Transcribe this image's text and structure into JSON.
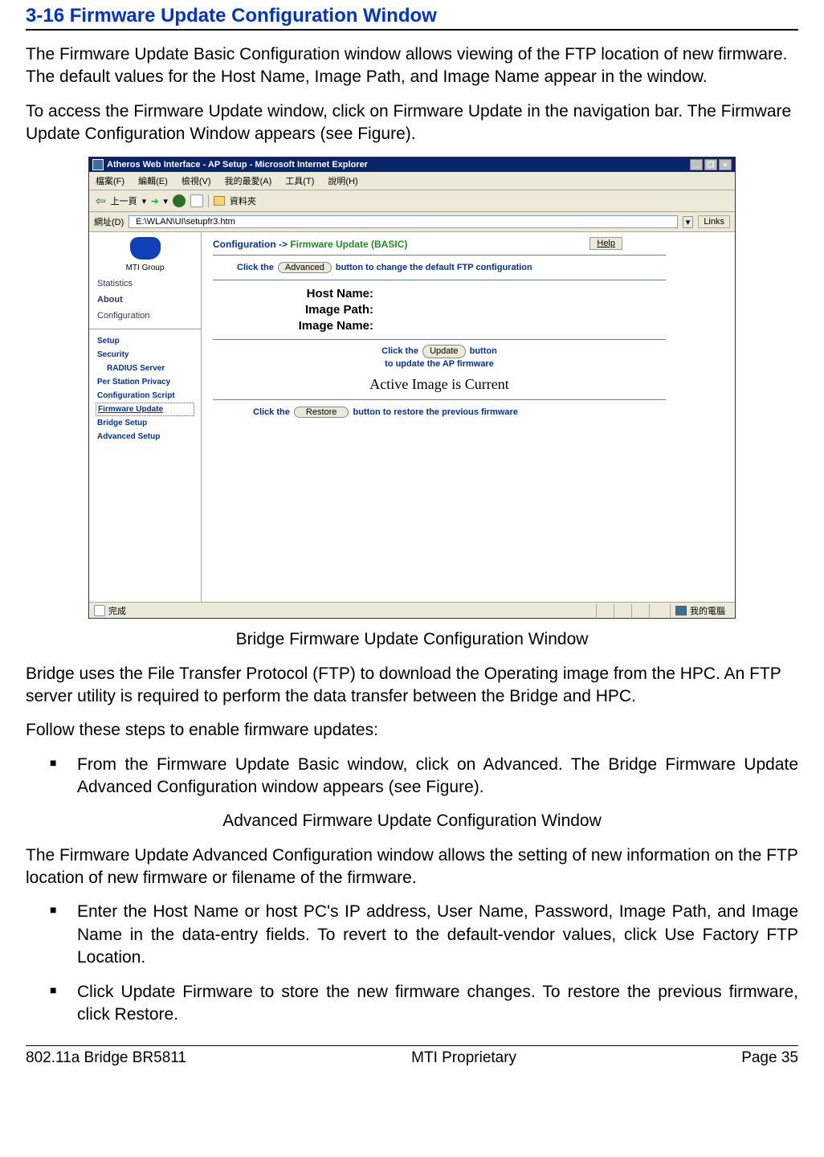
{
  "section_title": "3-16 Firmware Update Configuration Window",
  "paras": {
    "intro1": "The Firmware Update Basic Configuration window allows viewing of the FTP location of new firmware. The default values for the Host Name, Image Path, and Image Name appear in the window.",
    "intro2": "To access the Firmware Update window, click on Firmware Update in the navigation bar. The Firmware Update Configuration Window appears (see Figure).",
    "caption1": "Bridge Firmware Update Configuration Window",
    "para3": "Bridge uses the File Transfer Protocol (FTP) to download the Operating image from the HPC. An FTP server utility is required to perform the data transfer between the Bridge and HPC.",
    "para4": "Follow these steps to enable firmware updates:",
    "bullet1": "From the Firmware Update Basic window, click on Advanced. The Bridge Firmware Update Advanced Configuration window appears (see Figure).",
    "caption2": "Advanced Firmware Update Configuration Window",
    "para5": "The Firmware Update Advanced Configuration window allows the setting of new information on the FTP location of new firmware or filename of the firmware.",
    "bullet2": "Enter the Host Name or host PC's IP address, User Name, Password, Image Path, and Image Name in the data-entry fields. To revert to the default-vendor values, click Use Factory FTP Location.",
    "bullet3": "Click Update Firmware to store the new firmware changes. To restore the previous firmware, click Restore."
  },
  "shot": {
    "win_title": "Atheros Web Interface - AP Setup - Microsoft Internet Explorer",
    "menus": [
      "檔案(F)",
      "編輯(E)",
      "檢視(V)",
      "我的最愛(A)",
      "工具(T)",
      "說明(H)"
    ],
    "toolbar": {
      "back": "上一頁",
      "folders": "資料夾"
    },
    "addr_label": "網址(D)",
    "addr_value": "E:\\WLAN\\UI\\setupfr3.htm",
    "links_label": "Links",
    "sidebar": {
      "logo_label": "MTI Group",
      "items_top": [
        "Statistics",
        "About",
        "Configuration"
      ],
      "items_sub": [
        "Setup",
        "Security",
        "RADIUS Server",
        "Per Station Privacy",
        "Configuration Script",
        "Firmware Update",
        "Bridge Setup",
        "Advanced Setup"
      ]
    },
    "main": {
      "breadcrumb_a": "Configuration  -> ",
      "breadcrumb_b": "Firmware Update (BASIC)",
      "help": "Help",
      "hint_adv_pre": "Click the ",
      "hint_adv_btn": "Advanced",
      "hint_adv_post": " button to change the default FTP configuration",
      "fields": {
        "host": "Host Name:",
        "path": "Image Path:",
        "name": "Image Name:"
      },
      "hint_upd_pre": "Click the ",
      "hint_upd_btn": "Update",
      "hint_upd_post": " button",
      "hint_upd_line2": "to update the AP firmware",
      "status": "Active Image is Current",
      "hint_res_pre": "Click the ",
      "hint_res_btn": "Restore",
      "hint_res_post": " button to restore the previous firmware"
    },
    "statusbar": {
      "done": "完成",
      "mycomp": "我的電腦"
    }
  },
  "footer": {
    "left": "802.11a Bridge BR5811",
    "center": "MTI Proprietary",
    "right": "Page 35"
  }
}
